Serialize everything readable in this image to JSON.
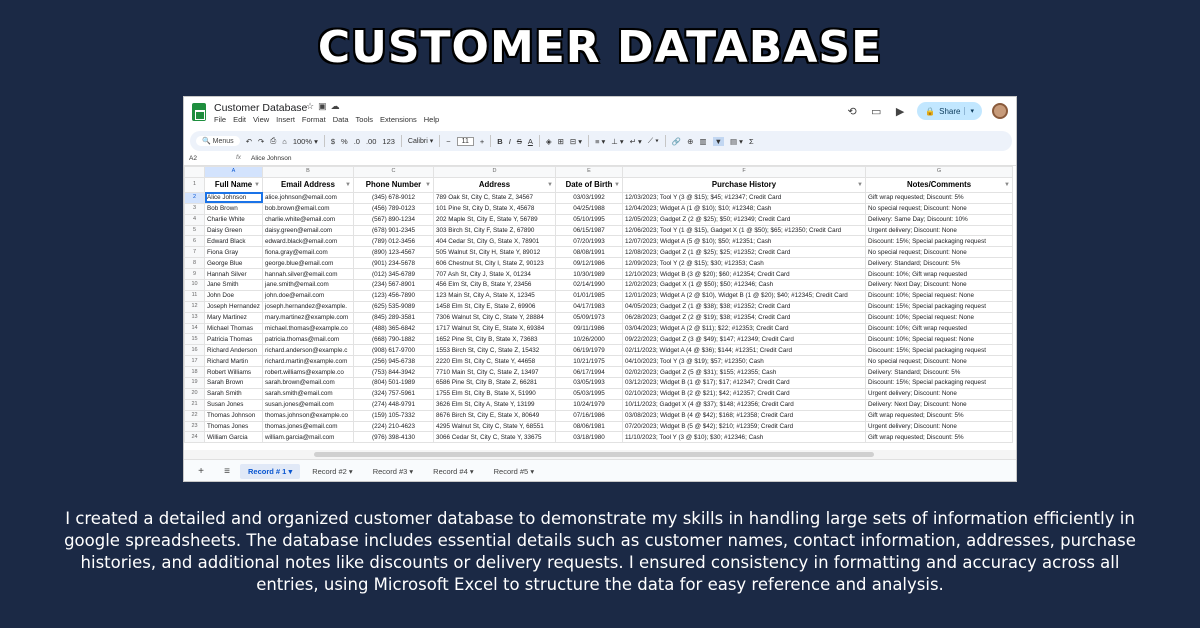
{
  "poster": {
    "title": "CUSTOMER DATABASE",
    "caption": "I created a detailed and organized customer database to demonstrate my skills in handling large sets of information efficiently in google spreadsheets. The database includes essential details such as customer names, contact information, addresses, purchase histories, and additional notes like discounts or delivery requests. I ensured consistency in formatting and accuracy across all entries, using Microsoft Excel to structure the data for easy reference and analysis."
  },
  "app": {
    "doc_title": "Customer Database",
    "menus": [
      "File",
      "Edit",
      "View",
      "Insert",
      "Format",
      "Data",
      "Tools",
      "Extensions",
      "Help"
    ],
    "share_label": "Share"
  },
  "toolbar": {
    "menus_label": "Menus",
    "zoom": "100%",
    "currency": "$",
    "percent": "%",
    "dec_decrease": ".0",
    "dec_increase": ".00",
    "number_format": "123",
    "font": "Calibri",
    "font_size": "11",
    "sigma": "Σ"
  },
  "formula_bar": {
    "cell_ref": "A2",
    "fx": "fx",
    "content": "Alice Johnson"
  },
  "grid": {
    "column_letters": [
      "A",
      "B",
      "C",
      "D",
      "E",
      "F",
      "G"
    ],
    "headers": [
      "Full Name",
      "Email Address",
      "Phone Number",
      "Address",
      "Date of Birth",
      "Purchase History",
      "Notes/Comments"
    ],
    "rows": [
      {
        "n": "2",
        "cells": [
          "Alice Johnson",
          "alice.johnson@email.com",
          "(345) 678-9012",
          "789 Oak St, City C, State Z, 34567",
          "03/03/1992",
          "12/03/2023; Tool Y (3 @ $15); $45; #12347; Credit Card",
          "Gift wrap requested; Discount: 5%"
        ]
      },
      {
        "n": "3",
        "cells": [
          "Bob Brown",
          "bob.brown@email.com",
          "(456) 789-0123",
          "101 Pine St, City D, State X, 45678",
          "04/25/1988",
          "12/04/2023; Widget A (1 @ $10); $10; #12348; Cash",
          "No special request; Discount: None"
        ]
      },
      {
        "n": "4",
        "cells": [
          "Charlie White",
          "charlie.white@email.com",
          "(567) 890-1234",
          "202 Maple St, City E, State Y, 56789",
          "05/10/1995",
          "12/05/2023; Gadget Z (2 @ $25); $50; #12349; Credit Card",
          "Delivery: Same Day; Discount: 10%"
        ]
      },
      {
        "n": "5",
        "cells": [
          "Daisy Green",
          "daisy.green@email.com",
          "(678) 901-2345",
          "303 Birch St, City F, State Z, 67890",
          "06/15/1987",
          "12/06/2023; Tool Y (1 @ $15), Gadget X (1 @ $50); $65; #12350; Credit Card",
          "Urgent delivery; Discount: None"
        ]
      },
      {
        "n": "6",
        "cells": [
          "Edward Black",
          "edward.black@email.com",
          "(789) 012-3456",
          "404 Cedar St, City G, State X, 78901",
          "07/20/1993",
          "12/07/2023; Widget A (5 @ $10); $50; #12351; Cash",
          "Discount: 15%; Special packaging request"
        ]
      },
      {
        "n": "7",
        "cells": [
          "Fiona Gray",
          "fiona.gray@email.com",
          "(890) 123-4567",
          "505 Walnut St, City H, State Y, 89012",
          "08/08/1991",
          "12/08/2023; Gadget Z (1 @ $25); $25; #12352; Credit Card",
          "No special request; Discount: None"
        ]
      },
      {
        "n": "8",
        "cells": [
          "George Blue",
          "george.blue@email.com",
          "(901) 234-5678",
          "606 Chestnut St, City I, State Z, 90123",
          "09/12/1986",
          "12/09/2023; Tool Y (2 @ $15); $30; #12353; Cash",
          "Delivery: Standard; Discount: 5%"
        ]
      },
      {
        "n": "9",
        "cells": [
          "Hannah Silver",
          "hannah.silver@email.com",
          "(012) 345-6789",
          "707 Ash St, City J, State X, 01234",
          "10/30/1989",
          "12/10/2023; Widget B (3 @ $20); $60; #12354; Credit Card",
          "Discount: 10%; Gift wrap requested"
        ]
      },
      {
        "n": "10",
        "cells": [
          "Jane Smith",
          "jane.smith@email.com",
          "(234) 567-8901",
          "456 Elm St, City B, State Y, 23456",
          "02/14/1990",
          "12/02/2023; Gadget X (1 @ $50); $50; #12346; Cash",
          "Delivery: Next Day; Discount: None"
        ]
      },
      {
        "n": "11",
        "cells": [
          "John Doe",
          "john.doe@email.com",
          "(123) 456-7890",
          "123 Main St, City A, State X, 12345",
          "01/01/1985",
          "12/01/2023; Widget A (2 @ $10), Widget B (1 @ $20); $40; #12345; Credit Card",
          "Discount: 10%; Special request: None"
        ]
      },
      {
        "n": "12",
        "cells": [
          "Joseph Hernandez",
          "joseph.hernandez@example.",
          "(625) 535-9089",
          "1458 Elm St, City E, State Z, 69906",
          "04/17/1983",
          "04/05/2023; Gadget Z (1 @ $38); $38; #12352; Credit Card",
          "Discount: 15%; Special packaging request"
        ]
      },
      {
        "n": "13",
        "cells": [
          "Mary Martinez",
          "mary.martinez@example.com",
          "(845) 289-3581",
          "7306 Walnut St, City C, State Y, 28884",
          "05/09/1973",
          "06/28/2023; Gadget Z (2 @ $19); $38; #12354; Credit Card",
          "Discount: 10%; Special request: None"
        ]
      },
      {
        "n": "14",
        "cells": [
          "Michael Thomas",
          "michael.thomas@example.co",
          "(488) 365-6842",
          "1717 Walnut St, City E, State X, 69384",
          "09/11/1986",
          "03/04/2023; Widget A (2 @ $11); $22; #12353; Credit Card",
          "Discount: 10%; Gift wrap requested"
        ]
      },
      {
        "n": "15",
        "cells": [
          "Patricia Thomas",
          "patricia.thomas@mail.com",
          "(668) 790-1882",
          "1652 Pine St, City B, State X, 73683",
          "10/26/2000",
          "09/22/2023; Gadget Z (3 @ $49); $147; #12349; Credit Card",
          "Discount: 10%; Special request: None"
        ]
      },
      {
        "n": "16",
        "cells": [
          "Richard Anderson",
          "richard.anderson@example.c",
          "(908) 617-9700",
          "1553 Birch St, City C, State Z, 15432",
          "06/19/1979",
          "02/11/2023; Widget A (4 @ $36); $144; #12351; Credit Card",
          "Discount: 15%; Special packaging request"
        ]
      },
      {
        "n": "17",
        "cells": [
          "Richard Martin",
          "richard.martin@example.com",
          "(256) 945-6738",
          "2220 Elm St, City C, State Y, 44658",
          "10/21/1975",
          "04/10/2023; Tool Y (3 @ $19); $57; #12350; Cash",
          "No special request; Discount: None"
        ]
      },
      {
        "n": "18",
        "cells": [
          "Robert Williams",
          "robert.williams@example.co",
          "(753) 844-3942",
          "7710 Main St, City C, State Z, 13497",
          "06/17/1994",
          "02/02/2023; Gadget Z (5 @ $31); $155; #12355; Cash",
          "Delivery: Standard; Discount: 5%"
        ]
      },
      {
        "n": "19",
        "cells": [
          "Sarah Brown",
          "sarah.brown@email.com",
          "(804) 501-1989",
          "6586 Pine St, City B, State Z, 66281",
          "03/05/1993",
          "03/12/2023; Widget B (1 @ $17); $17; #12347; Credit Card",
          "Discount: 15%; Special packaging request"
        ]
      },
      {
        "n": "20",
        "cells": [
          "Sarah Smith",
          "sarah.smith@email.com",
          "(324) 757-5961",
          "1755 Elm St, City B, State X, 51990",
          "05/03/1995",
          "02/10/2023; Widget B (2 @ $21); $42; #12357; Credit Card",
          "Urgent delivery; Discount: None"
        ]
      },
      {
        "n": "21",
        "cells": [
          "Susan Jones",
          "susan.jones@email.com",
          "(274) 448-9791",
          "3626 Elm St, City A, State Y, 13199",
          "10/24/1979",
          "10/11/2023; Gadget X (4 @ $37); $148; #12356; Credit Card",
          "Delivery: Next Day; Discount: None"
        ]
      },
      {
        "n": "22",
        "cells": [
          "Thomas Johnson",
          "thomas.johnson@example.co",
          "(159) 105-7332",
          "8676 Birch St, City E, State X, 80649",
          "07/16/1986",
          "03/08/2023; Widget B (4 @ $42); $168; #12358; Credit Card",
          "Gift wrap requested; Discount: 5%"
        ]
      },
      {
        "n": "23",
        "cells": [
          "Thomas Jones",
          "thomas.jones@email.com",
          "(224) 210-4623",
          "4295 Walnut St, City C, State Y, 68551",
          "08/06/1981",
          "07/20/2023; Widget B (5 @ $42); $210; #12359; Credit Card",
          "Urgent delivery; Discount: None"
        ]
      },
      {
        "n": "24",
        "cells": [
          "William Garcia",
          "william.garcia@mail.com",
          "(976) 398-4130",
          "3066 Cedar St, City C, State Y, 33675",
          "03/18/1980",
          "11/10/2023; Tool Y (3 @ $10); $30; #12346; Cash",
          "Gift wrap requested; Discount: 5%"
        ]
      }
    ]
  },
  "tabs": [
    "Record # 1",
    "Record #2",
    "Record #3",
    "Record #4",
    "Record #5"
  ],
  "colors": {
    "background": "#1b2945",
    "accent": "#0b57d0",
    "sheets_green": "#1e8e3e"
  }
}
